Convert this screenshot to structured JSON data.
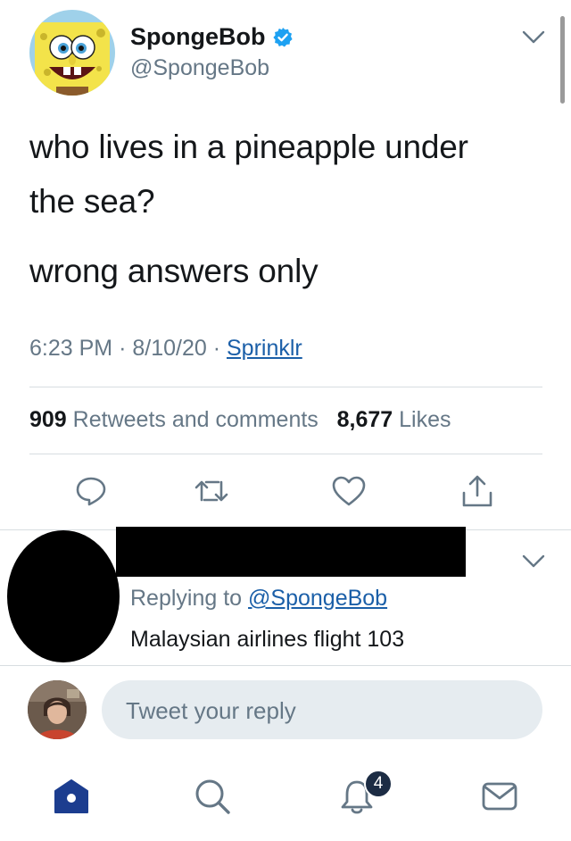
{
  "tweet": {
    "author": {
      "name": "SpongeBob",
      "handle": "@SpongeBob",
      "verified": true,
      "avatar": "spongebob-avatar"
    },
    "text_line1": "who lives in a pineapple under",
    "text_line2": "the sea?",
    "text_line3": "wrong answers only",
    "time": "6:23 PM",
    "date": "8/10/20",
    "separator": "·",
    "source": "Sprinklr",
    "retweets_count": "909",
    "retweets_label": "Retweets and comments",
    "likes_count": "8,677",
    "likes_label": "Likes",
    "actions": [
      "reply-icon",
      "retweet-icon",
      "like-icon",
      "share-icon"
    ]
  },
  "reply": {
    "replying_prefix": "Replying to",
    "replying_to": "@SpongeBob",
    "text": "Malaysian airlines flight 103"
  },
  "composer": {
    "placeholder": "Tweet your reply"
  },
  "tabbar": {
    "items": [
      "home-icon",
      "search-icon",
      "notifications-icon",
      "messages-icon"
    ],
    "notifications_badge": "4",
    "active": "home"
  },
  "colors": {
    "text": "#14171a",
    "secondary": "#657786",
    "link": "#1b5fa8",
    "verified": "#1da1f2",
    "active_tab": "#1c3d8f",
    "input_bg": "#e6ecf0"
  }
}
